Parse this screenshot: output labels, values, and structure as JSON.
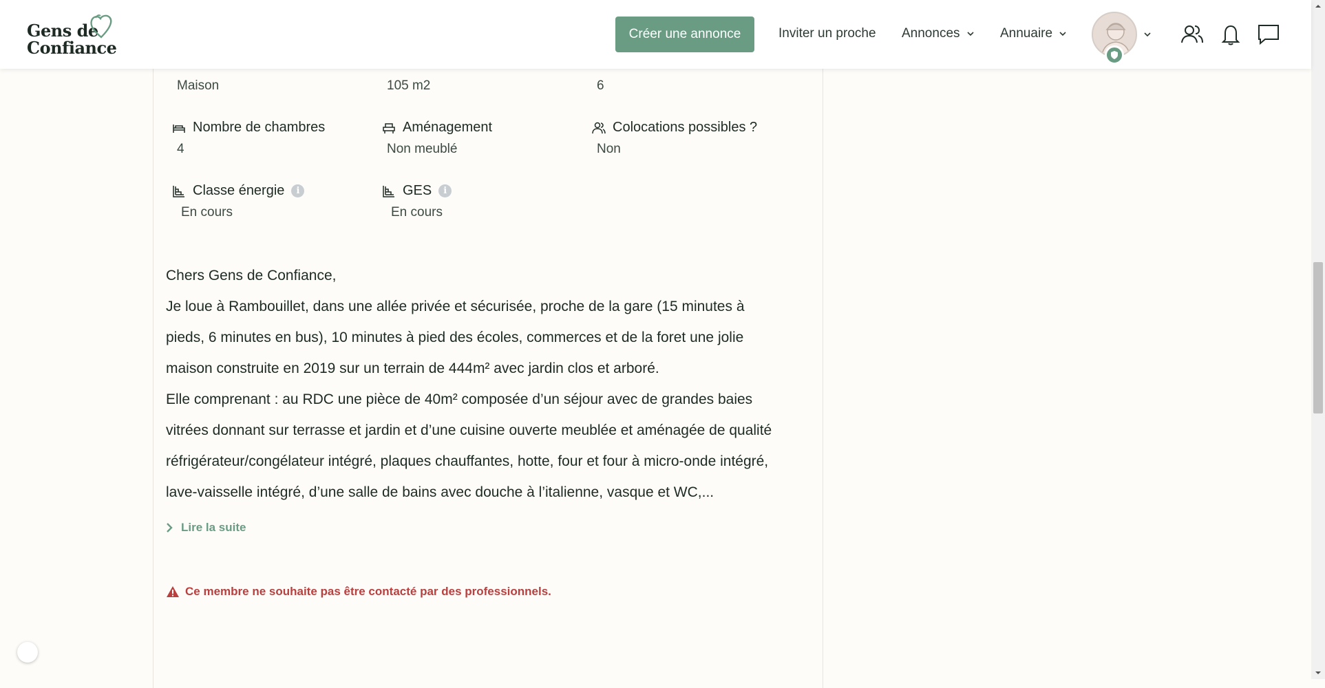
{
  "header": {
    "logo_line1": "Gens de",
    "logo_line2": "Confiance",
    "create_button": "Créer une annonce",
    "invite_link": "Inviter un proche",
    "announces_menu": "Annonces",
    "directory_menu": "Annuaire",
    "icons": [
      "user-group-icon",
      "bell-icon",
      "chat-icon"
    ]
  },
  "listing": {
    "top_row": [
      {
        "value": "Maison"
      },
      {
        "value": "105 m2"
      },
      {
        "value": "6"
      }
    ],
    "attributes": [
      {
        "label": "Nombre de chambres",
        "value": "4",
        "icon": "bed-icon"
      },
      {
        "label": "Aménagement",
        "value": "Non meublé",
        "icon": "furniture-icon"
      },
      {
        "label": "Colocations possibles ?",
        "value": "Non",
        "icon": "people-icon"
      },
      {
        "label": "Classe énergie",
        "value": "En cours",
        "icon": "energy-icon"
      },
      {
        "label": "GES",
        "value": "En cours",
        "icon": "energy-icon"
      }
    ],
    "description": [
      "Chers Gens de Confiance,",
      "Je loue à Rambouillet, dans une allée privée et sécurisée, proche de la gare (15 minutes à",
      "pieds, 6 minutes en bus), 10 minutes à pied des écoles, commerces et de la foret une jolie",
      "maison construite en 2019 sur un terrain de 444m² avec jardin clos et arboré.",
      "Elle comprenant : au RDC une pièce de 40m² composée d’un séjour avec de grandes baies",
      "vitrées donnant sur terrasse et jardin et d’une cuisine ouverte meublée et aménagée de qualité",
      "réfrigérateur/congélateur intégré, plaques chauffantes, hotte, four et four à micro-onde intégré,",
      "lave-vaisselle intégré, d’une salle de bains avec douche à l’italienne, vasque et WC,..."
    ],
    "read_more": "Lire la suite",
    "warning": "Ce membre ne souhaite pas être contacté par des professionnels."
  },
  "colors": {
    "brand_green": "#6a9c83",
    "warning_red": "#b8403f"
  }
}
